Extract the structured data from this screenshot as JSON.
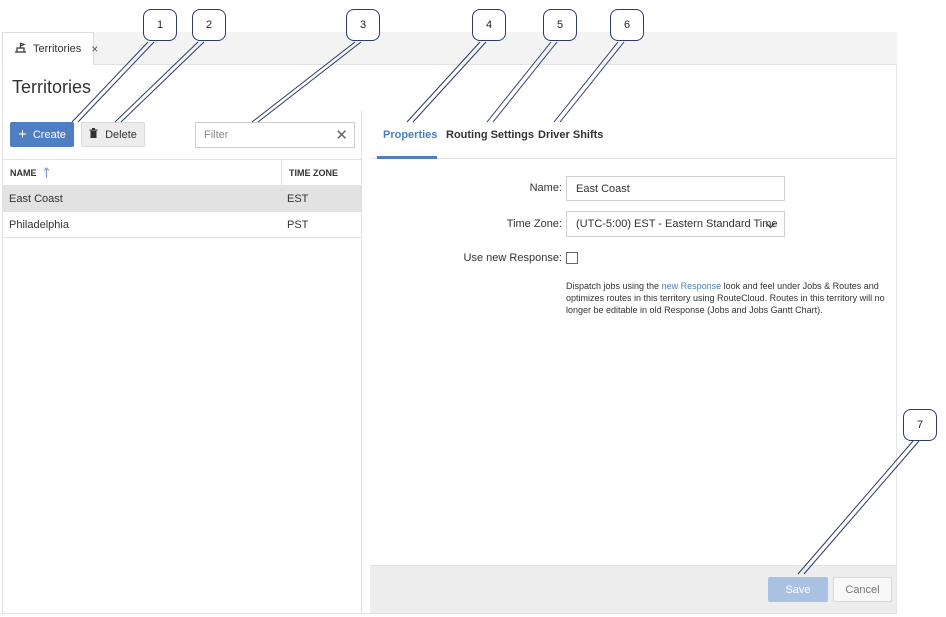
{
  "doc_tab": {
    "label": "Territories",
    "close": "×"
  },
  "page_title": "Territories",
  "toolbar": {
    "create_label": "Create",
    "delete_label": "Delete",
    "filter_placeholder": "Filter"
  },
  "grid": {
    "columns": [
      "NAME",
      "TIME ZONE"
    ],
    "rows": [
      {
        "name": "East Coast",
        "tz": "EST",
        "selected": true
      },
      {
        "name": "Philadelphia",
        "tz": "PST",
        "selected": false
      }
    ]
  },
  "tabs": [
    {
      "label": "Properties",
      "active": true
    },
    {
      "label": "Routing Settings",
      "active": false
    },
    {
      "label": "Driver Shifts",
      "active": false
    }
  ],
  "form": {
    "name_label": "Name:",
    "name_value": "East Coast",
    "tz_label": "Time Zone:",
    "tz_value": "(UTC-5:00) EST - Eastern Standard Time",
    "new_response_label": "Use new Response:",
    "new_response_checked": false,
    "help_pre": "Dispatch jobs using the ",
    "help_link": "new Response",
    "help_post": " look and feel under Jobs & Routes and optimizes routes in this territory using RouteCloud. Routes in this territory will no longer be editable in old Response (Jobs and Jobs Gantt Chart)."
  },
  "footer": {
    "save_label": "Save",
    "cancel_label": "Cancel"
  },
  "callouts": [
    "1",
    "2",
    "3",
    "4",
    "5",
    "6",
    "7"
  ],
  "colors": {
    "accent": "#4f7fc2",
    "save_disabled": "#a9c2e3",
    "selected_row": "#e2e2e2"
  }
}
